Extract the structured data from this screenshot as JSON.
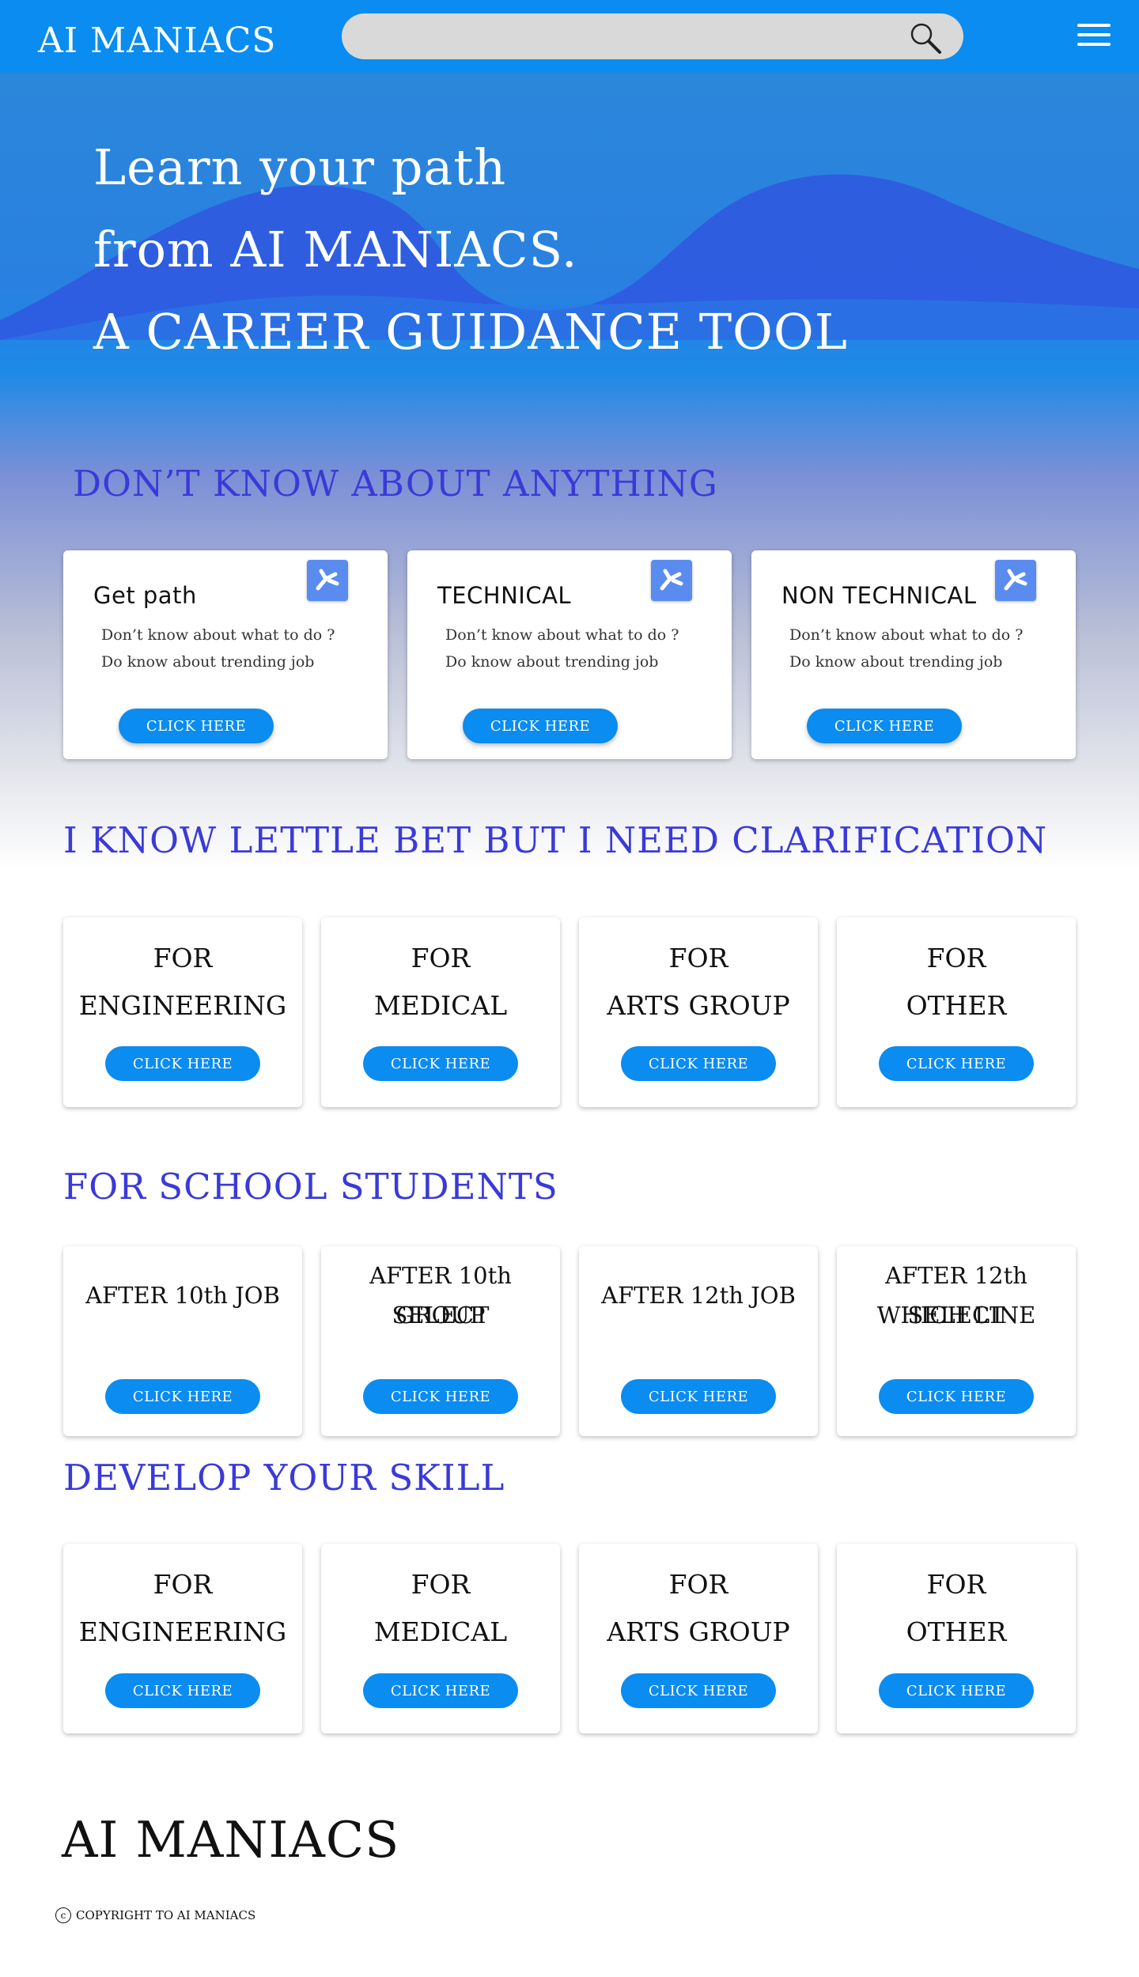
{
  "navbar": {
    "brand": "AI MANIACS",
    "search_placeholder": "",
    "search_icon": "search-icon",
    "menu_icon": "hamburger-menu-icon"
  },
  "hero": {
    "line1": "Learn your path",
    "line2": "from AI MANIACS.",
    "line3": "A CAREER GUIDANCE TOOL"
  },
  "sections": {
    "dont_know": {
      "heading": "DON’T KNOW ABOUT ANYTHING",
      "cards": [
        {
          "title": "Get path",
          "desc1": "Don’t know about what to do  ?",
          "desc2": "Do know about trending job",
          "button": "CLICK HERE"
        },
        {
          "title": "TECHNICAL",
          "desc1": "Don’t know about what to do  ?",
          "desc2": "Do know about trending job",
          "button": "CLICK HERE"
        },
        {
          "title": "NON TECHNICAL",
          "desc1": "Don’t know about what to do  ?",
          "desc2": "Do know about trending job",
          "button": "CLICK HERE"
        }
      ]
    },
    "clarification": {
      "heading": "I KNOW LETTLE BET BUT I NEED CLARIFICATION",
      "cards": [
        {
          "line1": "FOR",
          "line2": "ENGINEERING",
          "button": "CLICK HERE"
        },
        {
          "line1": "FOR",
          "line2": "MEDICAL",
          "button": "CLICK HERE"
        },
        {
          "line1": "FOR",
          "line2": "ARTS GROUP",
          "button": "CLICK HERE"
        },
        {
          "line1": "FOR",
          "line2": "OTHER",
          "button": "CLICK HERE"
        }
      ]
    },
    "school": {
      "heading": "FOR SCHOOL STUDENTS",
      "cards": [
        {
          "line1": "AFTER 10th JOB",
          "line2": "",
          "button": "CLICK HERE"
        },
        {
          "line1": "AFTER 10th SELECT",
          "line2": "GROUP",
          "button": "CLICK HERE"
        },
        {
          "line1": "AFTER 12th JOB",
          "line2": "",
          "button": "CLICK HERE"
        },
        {
          "line1": "AFTER 12th SELECT",
          "line2": "WHICH LINE",
          "button": "CLICK HERE"
        }
      ]
    },
    "skill": {
      "heading": "DEVELOP YOUR SKILL",
      "cards": [
        {
          "line1": "FOR",
          "line2": "ENGINEERING",
          "button": "CLICK HERE"
        },
        {
          "line1": "FOR",
          "line2": "MEDICAL",
          "button": "CLICK HERE"
        },
        {
          "line1": "FOR",
          "line2": "ARTS GROUP",
          "button": "CLICK HERE"
        },
        {
          "line1": "FOR",
          "line2": "OTHER",
          "button": "CLICK HERE"
        }
      ]
    }
  },
  "footer": {
    "brand": "AI MANIACS",
    "copyright_symbol": "c",
    "copyright": "COPYRIGHT TO AI MANIACS"
  },
  "colors": {
    "navbar": "#0a8cf0",
    "button": "#0a8cf0",
    "heading": "#3a3ad8",
    "badge": "#5a8cf0"
  }
}
